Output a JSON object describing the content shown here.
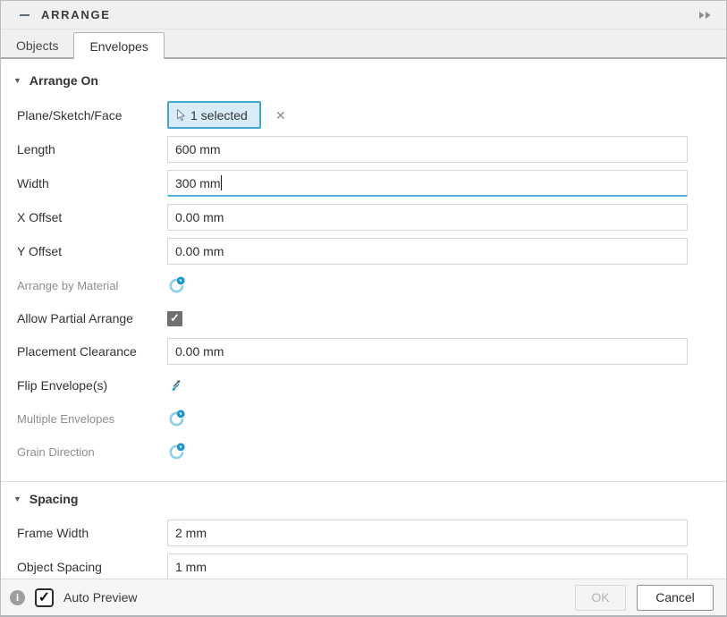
{
  "colors": {
    "accent": "#0696d7",
    "focus_underline": "#58b2d9",
    "selection_fill": "#d7ecf6",
    "selection_border": "#43a6cf",
    "panel_chrome": "#f0f0f0"
  },
  "icons": {
    "collapse": "minus-bar",
    "overflow": "double-arrow-right",
    "section_triangle": "▼",
    "clear": "✕",
    "check": "✓",
    "info": "i",
    "selection_cursor": "cursor-pointer",
    "flip": "diagonal-double-arrow",
    "computing": "spinner-badge"
  },
  "header": {
    "title": "ARRANGE"
  },
  "tabs": {
    "objects": "Objects",
    "envelopes": "Envelopes",
    "active": "Envelopes"
  },
  "arrange_on": {
    "title": "Arrange On",
    "plane": {
      "label": "Plane/Sketch/Face",
      "value": "1 selected"
    },
    "length": {
      "label": "Length",
      "value": "600 mm"
    },
    "width": {
      "label": "Width",
      "value": "300 mm",
      "focused": true
    },
    "x_offset": {
      "label": "X Offset",
      "value": "0.00 mm"
    },
    "y_offset": {
      "label": "Y Offset",
      "value": "0.00 mm"
    },
    "arrange_by_material": {
      "label": "Arrange by Material"
    },
    "allow_partial_arrange": {
      "label": "Allow Partial Arrange",
      "checked": true
    },
    "placement_clearance": {
      "label": "Placement Clearance",
      "value": "0.00 mm"
    },
    "flip_envelopes": {
      "label": "Flip Envelope(s)"
    },
    "multiple_envelopes": {
      "label": "Multiple Envelopes"
    },
    "grain_direction": {
      "label": "Grain Direction"
    }
  },
  "spacing": {
    "title": "Spacing",
    "frame_width": {
      "label": "Frame Width",
      "value": "2 mm"
    },
    "object_spacing": {
      "label": "Object Spacing",
      "value": "1 mm"
    }
  },
  "footer": {
    "auto_preview_label": "Auto Preview",
    "auto_preview_checked": true,
    "ok_label": "OK",
    "ok_enabled": false,
    "cancel_label": "Cancel"
  }
}
